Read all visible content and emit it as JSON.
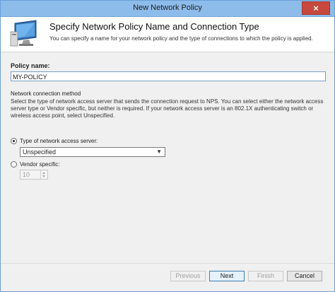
{
  "window": {
    "title": "New Network Policy",
    "close_glyph": "×"
  },
  "header": {
    "title": "Specify Network Policy Name and Connection Type",
    "description": "You can specify a name for your network policy and the type of connections to which the policy is applied.",
    "icon": "computer-monitor-icon"
  },
  "policy": {
    "label": "Policy name:",
    "value": "MY-POLICY"
  },
  "connection_method": {
    "heading": "Network connection method",
    "description": "Select the type of network access server that sends the connection request to NPS. You can select either the network access server type or Vendor specific, but neither is required.  If your network access server is an 802.1X authenticating switch or wireless access point, select Unspecified.",
    "type_radio_label": "Type of network access server:",
    "type_selected": true,
    "type_value": "Unspecified",
    "vendor_radio_label": "Vendor specific:",
    "vendor_selected": false,
    "vendor_value": "10"
  },
  "buttons": {
    "previous": "Previous",
    "next": "Next",
    "finish": "Finish",
    "cancel": "Cancel"
  },
  "colors": {
    "titlebar": "#8dbcea",
    "close_button": "#c7483d",
    "window_background": "#f0f0f0"
  }
}
